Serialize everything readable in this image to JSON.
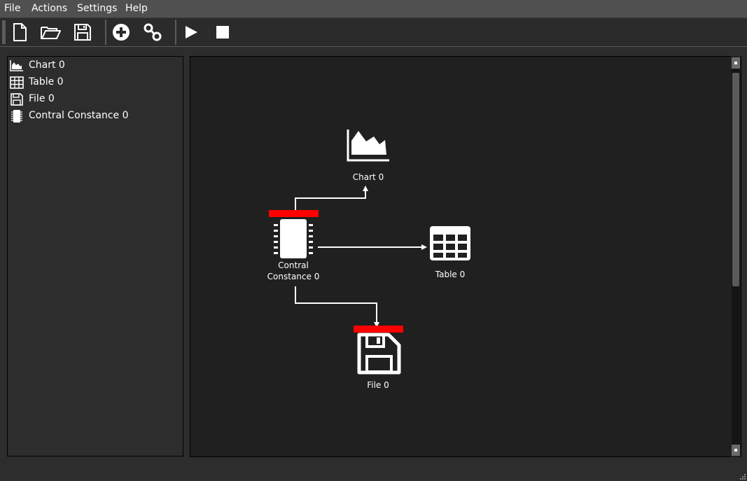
{
  "menubar": {
    "items": [
      "File",
      "Actions",
      "Settings",
      "Help"
    ]
  },
  "toolbar": {
    "buttons": [
      "new-file-icon",
      "open-folder-icon",
      "save-icon",
      "add-node-icon",
      "link-icon",
      "play-icon",
      "stop-icon"
    ]
  },
  "tree": {
    "items": [
      {
        "label": "Chart 0",
        "icon": "chart-icon"
      },
      {
        "label": "Table 0",
        "icon": "table-icon"
      },
      {
        "label": "File 0",
        "icon": "save-icon"
      },
      {
        "label": "Contral Constance 0",
        "icon": "chip-icon"
      }
    ]
  },
  "canvas": {
    "nodes": {
      "chart": {
        "label": "Chart 0"
      },
      "table": {
        "label": "Table 0"
      },
      "file": {
        "label": "File 0"
      },
      "constance": {
        "label_line1": "Contral",
        "label_line2": "Constance 0"
      }
    }
  },
  "colors": {
    "accent_red": "#ff0000",
    "background": "#202020",
    "panel": "#2d2d2d",
    "menubar": "#505050"
  }
}
